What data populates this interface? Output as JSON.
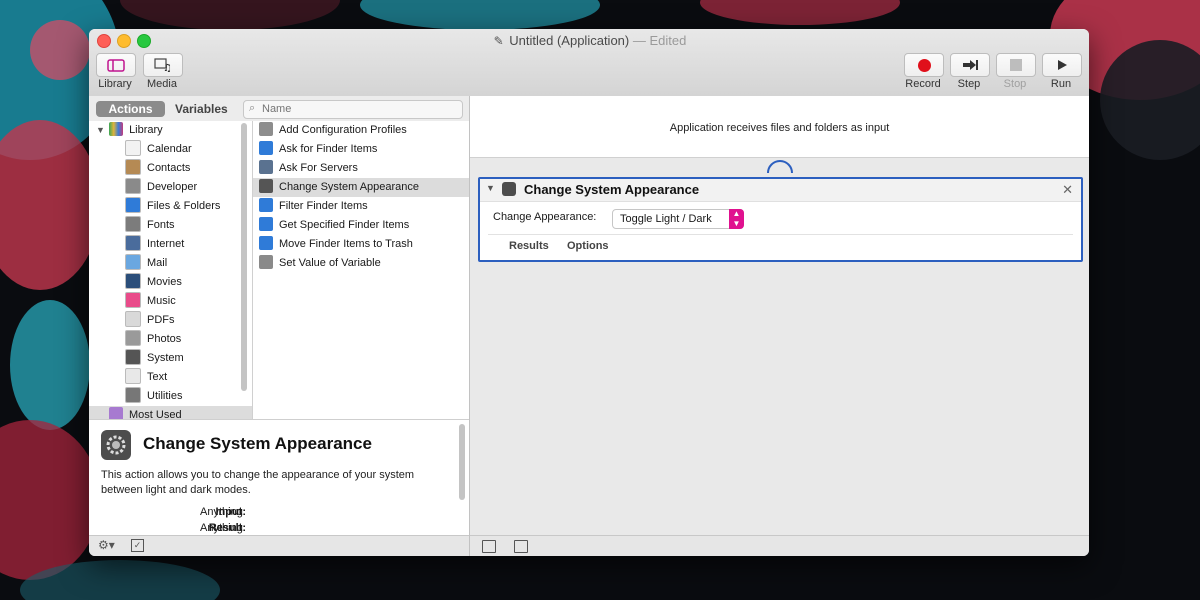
{
  "window": {
    "title": "Untitled (Application)",
    "status": "— Edited"
  },
  "toolbar": {
    "library_label": "Library",
    "media_label": "Media",
    "record_label": "Record",
    "step_label": "Step",
    "stop_label": "Stop",
    "run_label": "Run"
  },
  "tabs": {
    "actions": "Actions",
    "variables": "Variables"
  },
  "search": {
    "placeholder": "Name",
    "value": ""
  },
  "library": {
    "root": "Library",
    "items": [
      {
        "label": "Calendar",
        "icon": "calendar-icon",
        "color": "#f2f2f2"
      },
      {
        "label": "Contacts",
        "icon": "contacts-icon",
        "color": "#b58a54"
      },
      {
        "label": "Developer",
        "icon": "developer-icon",
        "color": "#8a8a8a"
      },
      {
        "label": "Files & Folders",
        "icon": "finder-icon",
        "color": "#2f7bd8"
      },
      {
        "label": "Fonts",
        "icon": "fonts-icon",
        "color": "#7c7c7c"
      },
      {
        "label": "Internet",
        "icon": "internet-icon",
        "color": "#4a6c9c"
      },
      {
        "label": "Mail",
        "icon": "mail-icon",
        "color": "#6aa7e0"
      },
      {
        "label": "Movies",
        "icon": "movies-icon",
        "color": "#2b4e7a"
      },
      {
        "label": "Music",
        "icon": "music-icon",
        "color": "#e94b8a"
      },
      {
        "label": "PDFs",
        "icon": "pdf-icon",
        "color": "#d9d9d9"
      },
      {
        "label": "Photos",
        "icon": "photos-icon",
        "color": "#9a9a9a"
      },
      {
        "label": "System",
        "icon": "system-icon",
        "color": "#555555"
      },
      {
        "label": "Text",
        "icon": "text-icon",
        "color": "#e8e8e8"
      },
      {
        "label": "Utilities",
        "icon": "utilities-icon",
        "color": "#777777"
      }
    ],
    "most_used": "Most Used"
  },
  "actions": {
    "items": [
      {
        "label": "Add Configuration Profiles",
        "icon": "profile-icon",
        "color": "#8d8d8d"
      },
      {
        "label": "Ask for Finder Items",
        "icon": "finder-icon",
        "color": "#2f7bd8"
      },
      {
        "label": "Ask For Servers",
        "icon": "server-icon",
        "color": "#5a7290"
      },
      {
        "label": "Change System Appearance",
        "icon": "system-icon",
        "color": "#555555",
        "selected": true
      },
      {
        "label": "Filter Finder Items",
        "icon": "finder-icon",
        "color": "#2f7bd8"
      },
      {
        "label": "Get Specified Finder Items",
        "icon": "finder-icon",
        "color": "#2f7bd8"
      },
      {
        "label": "Move Finder Items to Trash",
        "icon": "finder-icon",
        "color": "#2f7bd8"
      },
      {
        "label": "Set Value of Variable",
        "icon": "variable-icon",
        "color": "#8a8a8a"
      }
    ]
  },
  "description": {
    "title": "Change System Appearance",
    "text": "This action allows you to change the appearance of your system between light and dark modes.",
    "input_label": "Input:",
    "input_value": "Anything",
    "result_label": "Result:",
    "result_value": "Anything"
  },
  "workflow": {
    "header": "Application receives files and folders as input",
    "action": {
      "title": "Change System Appearance",
      "field_label": "Change Appearance:",
      "field_value": "Toggle Light / Dark",
      "results_label": "Results",
      "options_label": "Options"
    }
  },
  "colors": {
    "accent": "#2c5fbf",
    "select_arrow": "#e0118f",
    "record_red": "#e0101b"
  }
}
